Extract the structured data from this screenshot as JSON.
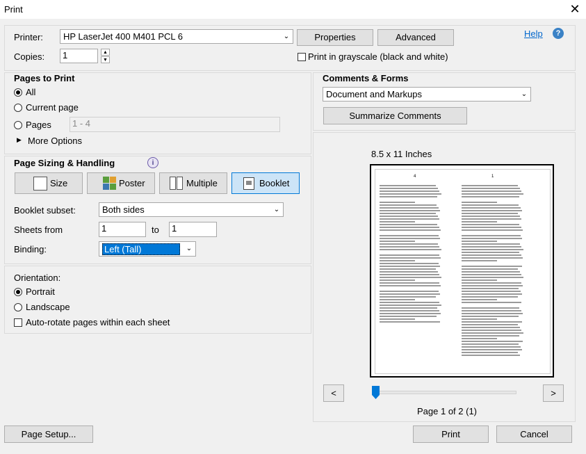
{
  "window": {
    "title": "Print",
    "close_glyph": "✕"
  },
  "printer": {
    "label": "Printer:",
    "value": "HP LaserJet 400 M401 PCL 6"
  },
  "copies": {
    "label": "Copies:",
    "value": "1"
  },
  "buttons": {
    "properties": "Properties",
    "advanced": "Advanced",
    "summarize": "Summarize Comments",
    "page_setup": "Page Setup...",
    "print": "Print",
    "cancel": "Cancel",
    "prev": "<",
    "next": ">"
  },
  "help": {
    "label": "Help"
  },
  "grayscale": {
    "label": "Print in grayscale (black and white)",
    "checked": false
  },
  "pages_to_print": {
    "heading": "Pages to Print",
    "all": "All",
    "current": "Current page",
    "pages": "Pages",
    "pages_value": "1 - 4",
    "more_options": "More Options",
    "selected": "all"
  },
  "comments": {
    "heading": "Comments & Forms",
    "value": "Document and Markups"
  },
  "sizing": {
    "heading": "Page Sizing & Handling",
    "modes": [
      "Size",
      "Poster",
      "Multiple",
      "Booklet"
    ],
    "selected_mode": "Booklet",
    "booklet_subset_label": "Booklet subset:",
    "booklet_subset_value": "Both sides",
    "sheets_from_label": "Sheets from",
    "sheets_from": "1",
    "sheets_to_label": "to",
    "sheets_to": "1",
    "binding_label": "Binding:",
    "binding_value": "Left (Tall)"
  },
  "orientation": {
    "heading": "Orientation:",
    "portrait": "Portrait",
    "landscape": "Landscape",
    "auto_rotate": "Auto-rotate pages within each sheet",
    "selected": "portrait",
    "auto_rotate_checked": false
  },
  "preview": {
    "size_label": "8.5 x 11 Inches",
    "left_page_num": "4",
    "right_page_num": "1",
    "page_status": "Page 1 of 2 (1)"
  },
  "colors": {
    "accent": "#0078d7",
    "selected_bg": "#cce4f7"
  }
}
